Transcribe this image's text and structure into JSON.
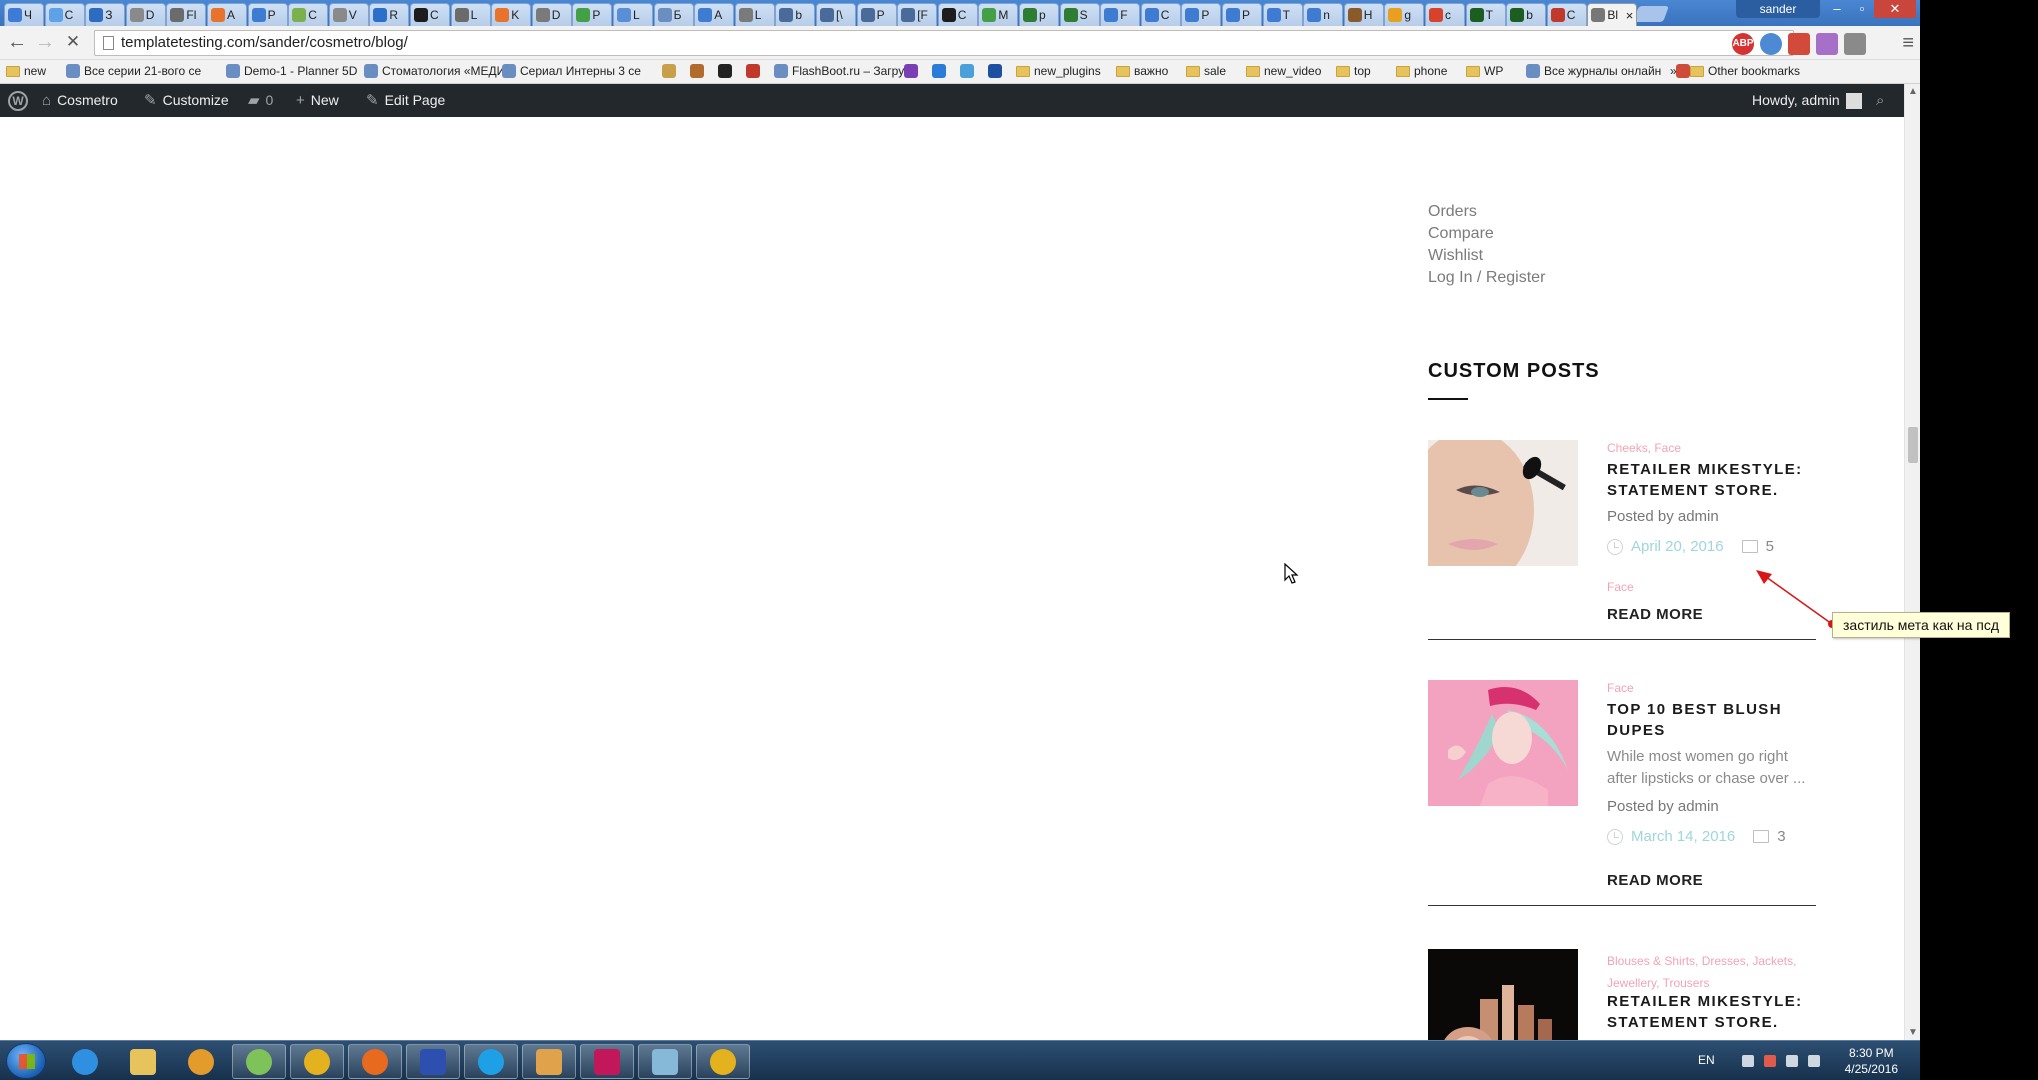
{
  "browser": {
    "tabs": [
      "Ч",
      "С",
      "З",
      "D",
      "Fl",
      "А",
      "Р",
      "С",
      "V",
      "R",
      "C",
      "L",
      "K",
      "D",
      "P",
      "L",
      "Б",
      "А",
      "L",
      "b",
      "[\\",
      "P",
      "[F",
      "C",
      "M",
      "p",
      "S",
      "F",
      "C",
      "P",
      "P",
      "T",
      "n",
      "H",
      "g",
      "c",
      "T",
      "b",
      "C",
      "Bl"
    ],
    "active_tab_label": "Bl",
    "window_user": "sander",
    "url": "templatetesting.com/sander/cosmetro/blog/",
    "bookmarks": [
      {
        "label": "new",
        "icon": "folder-icon"
      },
      {
        "label": "Все серии 21-вого се",
        "icon": "bookmark-icon"
      },
      {
        "label": "Demo-1 - Planner 5D",
        "icon": "bookmark-icon"
      },
      {
        "label": "Стоматология «МЕДИ",
        "icon": "bookmark-icon"
      },
      {
        "label": "Сериал Интерны 3 се",
        "icon": "bookmark-icon"
      },
      {
        "label": "FlashBoot.ru – Загруз",
        "icon": "bookmark-icon"
      },
      {
        "label": "new_plugins",
        "icon": "folder-icon"
      },
      {
        "label": "важно",
        "icon": "folder-icon"
      },
      {
        "label": "sale",
        "icon": "folder-icon"
      },
      {
        "label": "new_video",
        "icon": "folder-icon"
      },
      {
        "label": "top",
        "icon": "folder-icon"
      },
      {
        "label": "phone",
        "icon": "folder-icon"
      },
      {
        "label": "WP",
        "icon": "folder-icon"
      },
      {
        "label": "Все журналы онлайн",
        "icon": "bookmark-icon"
      }
    ],
    "bookmarks_overflow": "»",
    "other_bookmarks": "Other bookmarks",
    "extensions": [
      "ABP"
    ]
  },
  "adminbar": {
    "site_name": "Cosmetro",
    "customize": "Customize",
    "comments_count": "0",
    "new": "New",
    "edit_page": "Edit Page",
    "howdy": "Howdy, admin",
    "bg_color": "#23282d"
  },
  "account_links": [
    "Orders",
    "Compare",
    "Wishlist",
    "Log In / Register"
  ],
  "custom_posts": {
    "title": "CUSTOM POSTS",
    "posts": [
      {
        "categories": "Cheeks, Face",
        "title": "RETAILER MIKESTYLE: STATEMENT STORE.",
        "byline": "Posted by admin",
        "date": "April 20, 2016",
        "comments": "5",
        "tag": "Face",
        "read_more": "READ MORE"
      },
      {
        "categories": "Face",
        "title": "TOP 10 BEST BLUSH DUPES",
        "excerpt": "While most women go right after lipsticks or chase over ...",
        "byline": "Posted by admin",
        "date": "March 14, 2016",
        "comments": "3",
        "read_more": "READ MORE"
      },
      {
        "categories": "Blouses & Shirts, Dresses, Jackets, Jewellery, Trousers",
        "title": "RETAILER MIKESTYLE: STATEMENT STORE."
      }
    ]
  },
  "annotation": {
    "text": "застиль мета как на псд"
  },
  "taskbar": {
    "language": "EN",
    "time": "8:30 PM",
    "date": "4/25/2016",
    "apps": [
      "internet-explorer-icon",
      "file-explorer-icon",
      "media-player-icon",
      "network-icon",
      "chrome-icon",
      "firefox-icon",
      "save-icon",
      "skype-icon",
      "photo-viewer-icon",
      "s-app-icon",
      "notepad-icon",
      "chrome-icon"
    ]
  },
  "colors": {
    "category_pink": "#f2a3b7",
    "date_teal": "#9fd5dd",
    "link_gray": "#7b7b7b"
  }
}
